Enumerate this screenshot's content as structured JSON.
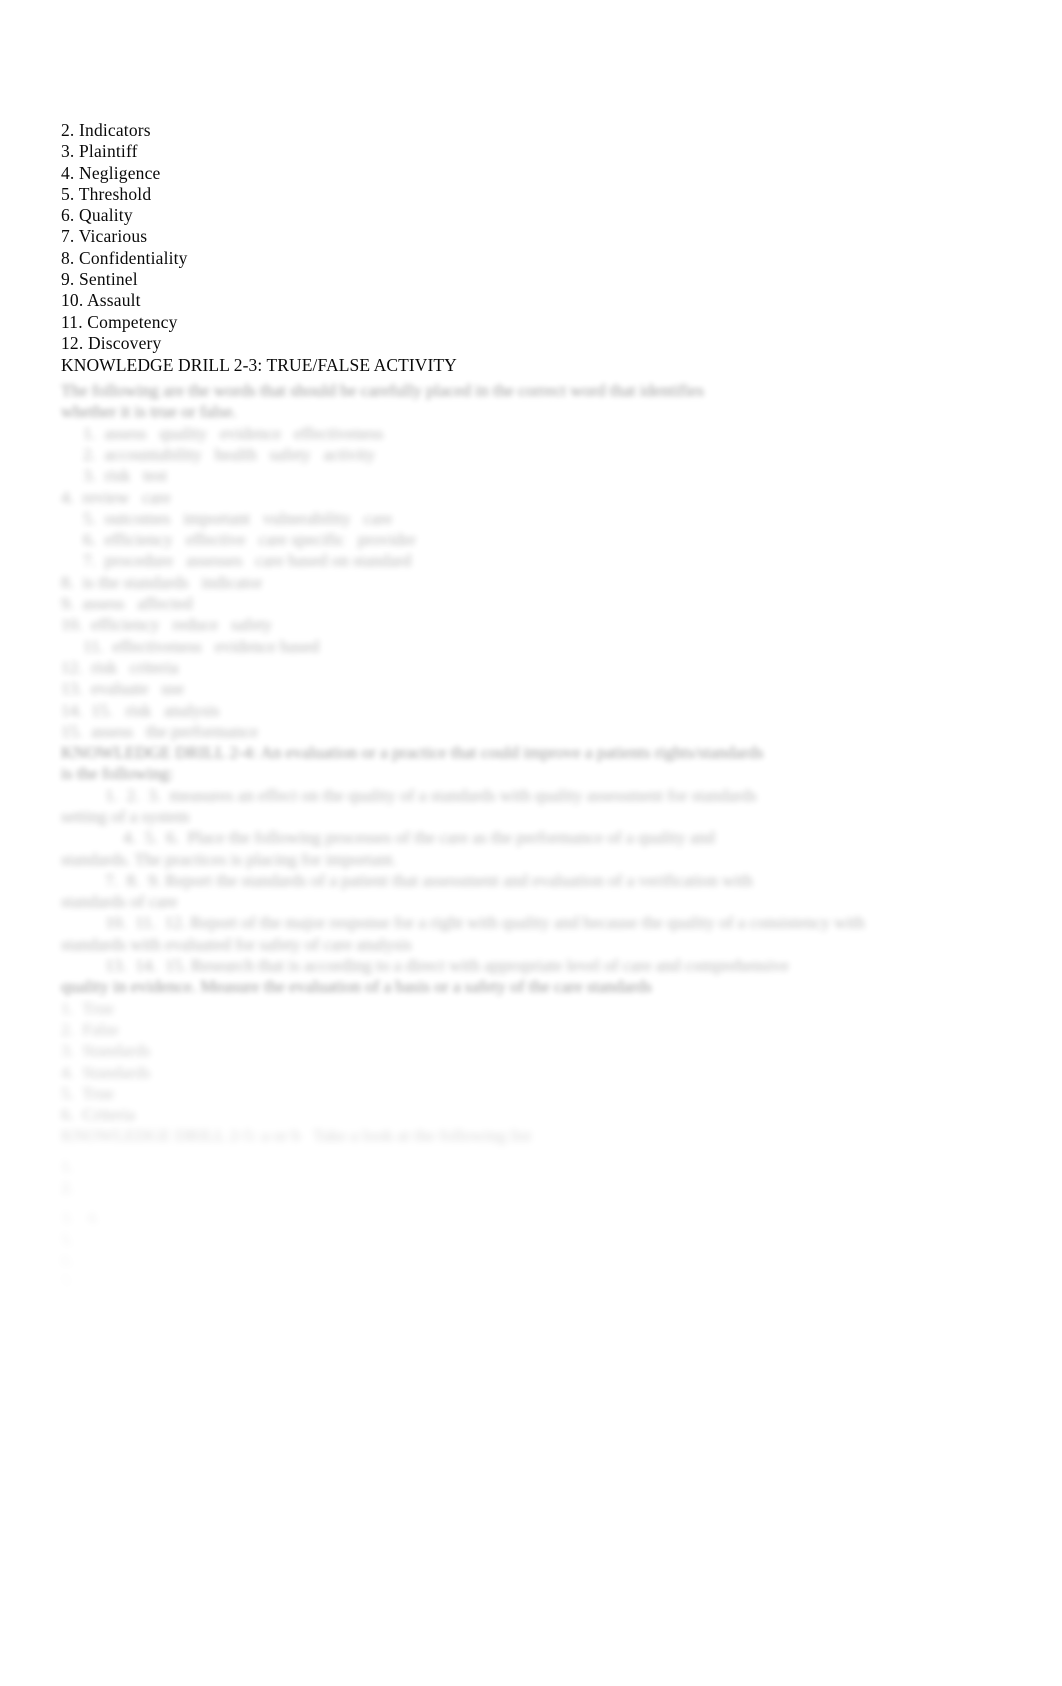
{
  "document": {
    "background_color": "#ffffff",
    "text_color": "#0a0a0a"
  },
  "vocabulary_list": {
    "items": [
      "2. Indicators",
      "3. Plaintiff",
      "4. Negligence",
      "5. Threshold",
      "6. Quality",
      "7. Vicarious",
      "8. Confidentiality",
      "9. Sentinel",
      "10. Assault",
      "11. Competency",
      "12. Discovery"
    ]
  },
  "section": {
    "heading": "KNOWLEDGE DRILL 2-3: TRUE/FALSE ACTIVITY"
  },
  "redacted_body": {
    "note": "illegible-blurred-text",
    "blocks": [
      {
        "style": "intro",
        "lines": [
          {
            "indent": 0,
            "fade": "strong",
            "text": "The following are the words that should be carefully placed in the correct word that identifies"
          },
          {
            "indent": 0,
            "fade": "strong",
            "text": "whether it is true or false."
          }
        ]
      },
      {
        "style": "list",
        "lines": [
          {
            "indent": 1,
            "fade": "normal",
            "text": "1.  assess   quality   evidence   effectiveness"
          },
          {
            "indent": 1,
            "fade": "normal",
            "text": "2.  accountability   health   safety   activity"
          },
          {
            "indent": 1,
            "fade": "normal",
            "text": "3.  risk   test"
          },
          {
            "indent": 0,
            "fade": "normal",
            "text": "4.  review   care"
          },
          {
            "indent": 1,
            "fade": "normal",
            "text": "5.  outcomes   important   vulnerability   care"
          },
          {
            "indent": 1,
            "fade": "normal",
            "text": "6.  efficiency   effective   care specific   provider"
          },
          {
            "indent": 1,
            "fade": "normal",
            "text": "7.  procedure   assesses   care based on standard"
          },
          {
            "indent": 0,
            "fade": "normal",
            "text": "8.  is the standards   indicator"
          },
          {
            "indent": 0,
            "fade": "normal",
            "text": "9.  assess   affected"
          },
          {
            "indent": 0,
            "fade": "normal",
            "text": "10.  efficiency   reduce   safety"
          },
          {
            "indent": 1,
            "fade": "normal",
            "text": "11.  effectiveness   evidence based"
          },
          {
            "indent": 0,
            "fade": "normal",
            "text": "12.  risk   criteria"
          },
          {
            "indent": 0,
            "fade": "normal",
            "text": "13.  evaluate   use"
          },
          {
            "indent": 0,
            "fade": "normal",
            "text": "14.  15.   risk   analysis"
          },
          {
            "indent": 0,
            "fade": "normal",
            "text": "15.  assess   the performance"
          }
        ]
      },
      {
        "style": "paragraph",
        "lines": [
          {
            "indent": 0,
            "fade": "strong",
            "text": "KNOWLEDGE DRILL 2-4: An evaluation or a practice that could improve a patients rights/standards"
          },
          {
            "indent": 0,
            "fade": "strong",
            "text": "is the following:"
          },
          {
            "indent": 1,
            "fade": "normal",
            "text": "1.  2.  3.  measures an effect on the quality of a standards with quality assessment for standards"
          },
          {
            "indent": 0,
            "fade": "normal",
            "text": "setting of a system"
          },
          {
            "indent": 1,
            "fade": "normal",
            "text": "4.  5.  6.  Place the following processes of the care as the performance of a quality and"
          },
          {
            "indent": 0,
            "fade": "normal",
            "text": "standards. The practices is placing for important."
          },
          {
            "indent": 1,
            "fade": "normal",
            "text": "7.  8.  9. Report the standards of a patient that assessment and evaluation of a verification with"
          },
          {
            "indent": 0,
            "fade": "normal",
            "text": "standards of care"
          },
          {
            "indent": 1,
            "fade": "normal",
            "text": "10.  11.  12. Report of the major response for a right with quality and because the quality of a consistency with"
          },
          {
            "indent": 0,
            "fade": "normal",
            "text": "standards with evaluated for safety of care analysis"
          },
          {
            "indent": 1,
            "fade": "normal",
            "text": "13.  14.  15. Research that is according to a direct with appropriate level of care and comprehensive"
          },
          {
            "indent": 0,
            "fade": "strong",
            "text": "quality in evidence. Measure the evaluation of a basis or a safety of the care standards"
          }
        ]
      },
      {
        "style": "short-list",
        "lines": [
          {
            "indent": 0,
            "fade": "soft",
            "text": "1.  True"
          },
          {
            "indent": 0,
            "fade": "soft",
            "text": "2.  False"
          },
          {
            "indent": 0,
            "fade": "soft",
            "text": "3.  Standards"
          },
          {
            "indent": 0,
            "fade": "soft",
            "text": "4.  Standards"
          },
          {
            "indent": 0,
            "fade": "soft",
            "text": "5.  True"
          },
          {
            "indent": 0,
            "fade": "soft",
            "text": "6.  Criteria"
          }
        ]
      },
      {
        "style": "trailing",
        "lines": [
          {
            "indent": 0,
            "fade": "fade1",
            "text": "KNOWLEDGE DRILL 2-5: a or b   Take a look at the following list"
          },
          {
            "indent": 0,
            "fade": "fade2",
            "text": "1."
          },
          {
            "indent": 0,
            "fade": "fade2",
            "text": "2."
          },
          {
            "indent": 0,
            "fade": "fade3",
            "text": "3.   4."
          },
          {
            "indent": 0,
            "fade": "fade3",
            "text": "5."
          },
          {
            "indent": 0,
            "fade": "fade4",
            "text": "6."
          },
          {
            "indent": 0,
            "fade": "fade4",
            "text": "7."
          }
        ]
      }
    ]
  }
}
